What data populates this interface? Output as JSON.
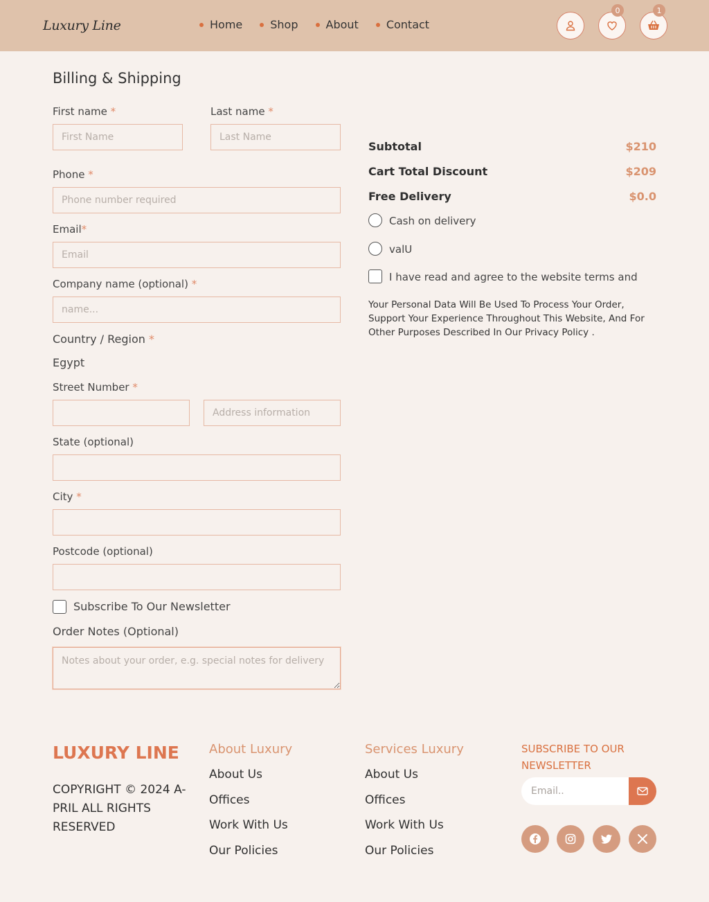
{
  "header": {
    "logo": "Luxury Line",
    "nav": [
      "Home",
      "Shop",
      "About",
      "Contact"
    ],
    "wishlist_count": "0",
    "cart_count": "1"
  },
  "form": {
    "title": "Billing & Shipping",
    "first_name_label": "First name",
    "first_name_placeholder": "First Name",
    "last_name_label": "Last name",
    "last_name_placeholder": "Last Name",
    "phone_label": "Phone",
    "phone_placeholder": "Phone number required",
    "email_label": "Email",
    "email_placeholder": "Email",
    "company_label": "Company name (optional)",
    "company_placeholder": "name...",
    "country_label": "Country / Region",
    "country_value": "Egypt",
    "street_label": "Street Number",
    "address_placeholder": "Address information",
    "state_label": "State (optional)",
    "city_label": "City",
    "postcode_label": "Postcode (optional)",
    "newsletter_label": "Subscribe To Our Newsletter",
    "notes_label": "Order Notes (Optional)",
    "notes_placeholder": "Notes about your order, e.g. special notes for delivery",
    "required_mark": "*"
  },
  "summary": {
    "subtotal_label": "Subtotal",
    "subtotal_value": "$210",
    "discount_label": "Cart Total Discount",
    "discount_value": "$209",
    "delivery_label": "Free Delivery",
    "delivery_value": "$0.0",
    "payment_options": [
      "Cash on delivery",
      "valU"
    ],
    "terms_label": "I have read and agree to the website terms and",
    "privacy_text": "Your Personal Data Will Be Used To Process Your Order, Support Your Experience Throughout This Website, And For Other Purposes Described In Our Privacy Policy ."
  },
  "footer": {
    "brand": "LUXURY LINE",
    "copyright": "COPYRIGHT © 2024 A-PRIL ALL RIGHTS RESERVED",
    "about_title": "About Luxury",
    "about_links": [
      "About Us",
      "Offices",
      "Work With Us",
      "Our Policies"
    ],
    "services_title": "Services Luxury",
    "services_links": [
      "About Us",
      "Offices",
      "Work With Us",
      "Our Policies"
    ],
    "newsletter_title": "SUBSCRIBE TO OUR NEWSLETTER",
    "email_placeholder": "Email..",
    "socials": [
      "facebook-icon",
      "instagram-icon",
      "twitter-icon",
      "x-icon"
    ]
  },
  "colors": {
    "header_bg": "#dfc2ab",
    "page_bg": "#f7f1ed",
    "accent": "#dd7650",
    "accent_soft": "#d59c80"
  }
}
